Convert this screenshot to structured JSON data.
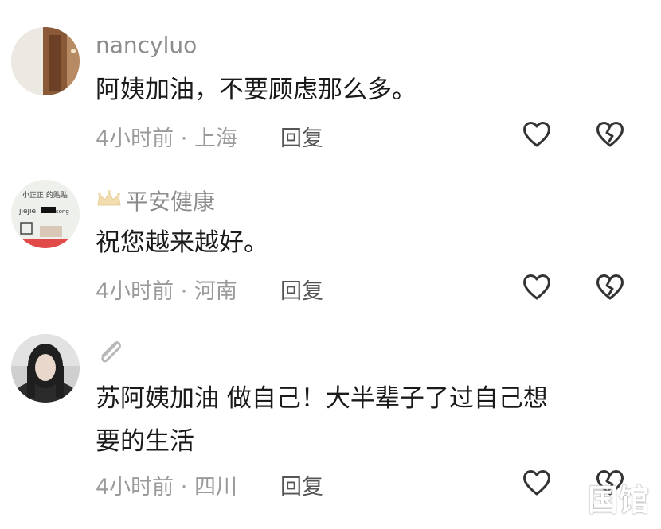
{
  "comments": [
    {
      "username": "nancyluo",
      "body_lines": [
        "阿姨加油，不要顾虑那么多。"
      ],
      "time": "4小时前",
      "location": "上海",
      "reply_label": "回复",
      "avatar": "avatar-photo-door",
      "has_crown": false
    },
    {
      "username": "平安健康",
      "body_lines": [
        "祝您越来越好。"
      ],
      "time": "4小时前",
      "location": "河南",
      "reply_label": "回复",
      "avatar": "avatar-handwritten-note",
      "has_crown": true
    },
    {
      "username": "",
      "body_lines": [
        "苏阿姨加油 做自己！大半辈子了过自己想",
        "要的生活"
      ],
      "time": "4小时前",
      "location": "四川",
      "reply_label": "回复",
      "avatar": "avatar-woman-portrait",
      "has_crown": false
    }
  ],
  "meta_separator": " · ",
  "icons": {
    "like": "heart-icon",
    "dislike": "broken-heart-icon",
    "badge": "crown-icon",
    "attachment": "paperclip-icon"
  },
  "colors": {
    "username": "#8c8c8c",
    "body": "#1a1a1a",
    "meta": "#9a9a9a",
    "icon_stroke": "#333333"
  },
  "watermark": "国馆"
}
